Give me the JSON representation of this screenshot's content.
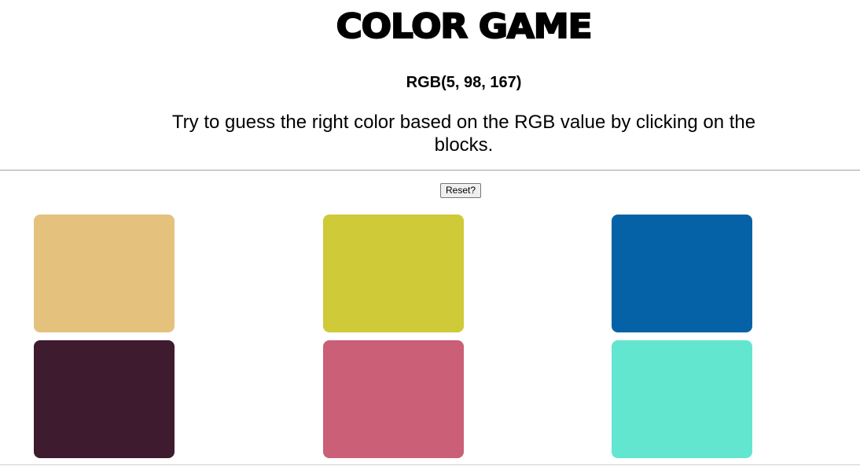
{
  "header": {
    "title": "COLOR GAME",
    "target_rgb": "RGB(5, 98, 167)",
    "instructions": "Try to guess the right color based on the RGB value by clicking on the blocks."
  },
  "controls": {
    "reset_label": "Reset?"
  },
  "squares": [
    {
      "color": "#e4c27e"
    },
    {
      "color": "#cfca37"
    },
    {
      "color": "#0562a7"
    },
    {
      "color": "#3f1b2f"
    },
    {
      "color": "#cb5f78"
    },
    {
      "color": "#63e6cf"
    }
  ]
}
